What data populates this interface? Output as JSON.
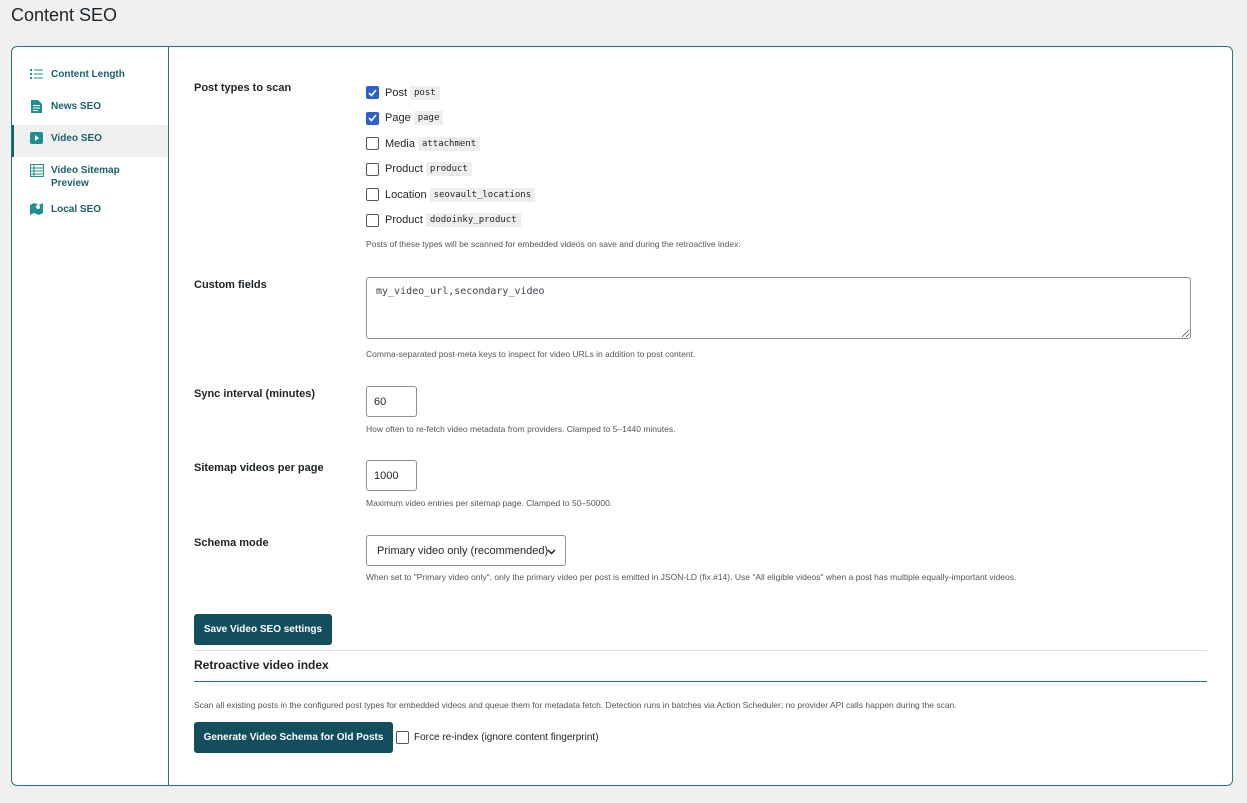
{
  "page_title": "Content SEO",
  "sidebar": {
    "items": [
      {
        "label": "Content Length",
        "icon": "list-icon"
      },
      {
        "label": "News SEO",
        "icon": "document-icon"
      },
      {
        "label": "Video SEO",
        "icon": "play-icon"
      },
      {
        "label": "Video Sitemap Preview",
        "icon": "table-icon"
      },
      {
        "label": "Local SEO",
        "icon": "map-icon"
      }
    ],
    "active": "Video SEO"
  },
  "post_types": {
    "label": "Post types to scan",
    "options": [
      {
        "label": "Post",
        "slug": "post",
        "checked": true
      },
      {
        "label": "Page",
        "slug": "page",
        "checked": true
      },
      {
        "label": "Media",
        "slug": "attachment",
        "checked": false
      },
      {
        "label": "Product",
        "slug": "product",
        "checked": false
      },
      {
        "label": "Location",
        "slug": "seovault_locations",
        "checked": false
      },
      {
        "label": "Product",
        "slug": "dodoinky_product",
        "checked": false
      }
    ],
    "help": "Posts of these types will be scanned for embedded videos on save and during the retroactive index."
  },
  "custom_fields": {
    "label": "Custom fields",
    "value": "my_video_url,secondary_video",
    "help": "Comma-separated post-meta keys to inspect for video URLs in addition to post content."
  },
  "sync_interval": {
    "label": "Sync interval (minutes)",
    "value": "60",
    "help": "How often to re-fetch video metadata from providers. Clamped to 5–1440 minutes."
  },
  "sitemap_per_page": {
    "label": "Sitemap videos per page",
    "value": "1000",
    "help": "Maximum video entries per sitemap page. Clamped to 50–50000."
  },
  "schema_mode": {
    "label": "Schema mode",
    "selected": "Primary video only (recommended)",
    "help": "When set to \"Primary video only\", only the primary video per post is emitted in JSON-LD (fix #14). Use \"All eligible videos\" when a post has multiple equally-important videos."
  },
  "save_button": "Save Video SEO settings",
  "retro": {
    "title": "Retroactive video index",
    "description": "Scan all existing posts in the configured post types for embedded videos and queue them for metadata fetch. Detection runs in batches via Action Scheduler; no provider API calls happen during the scan.",
    "button": "Generate Video Schema for Old Posts",
    "force_label": "Force re-index (ignore content fingerprint)",
    "force_checked": false
  },
  "colors": {
    "accent": "#134e5e",
    "sidebar_text": "#1a5f6a",
    "checkbox_on": "#2c5fd4",
    "border_teal": "#1f7a7d"
  }
}
